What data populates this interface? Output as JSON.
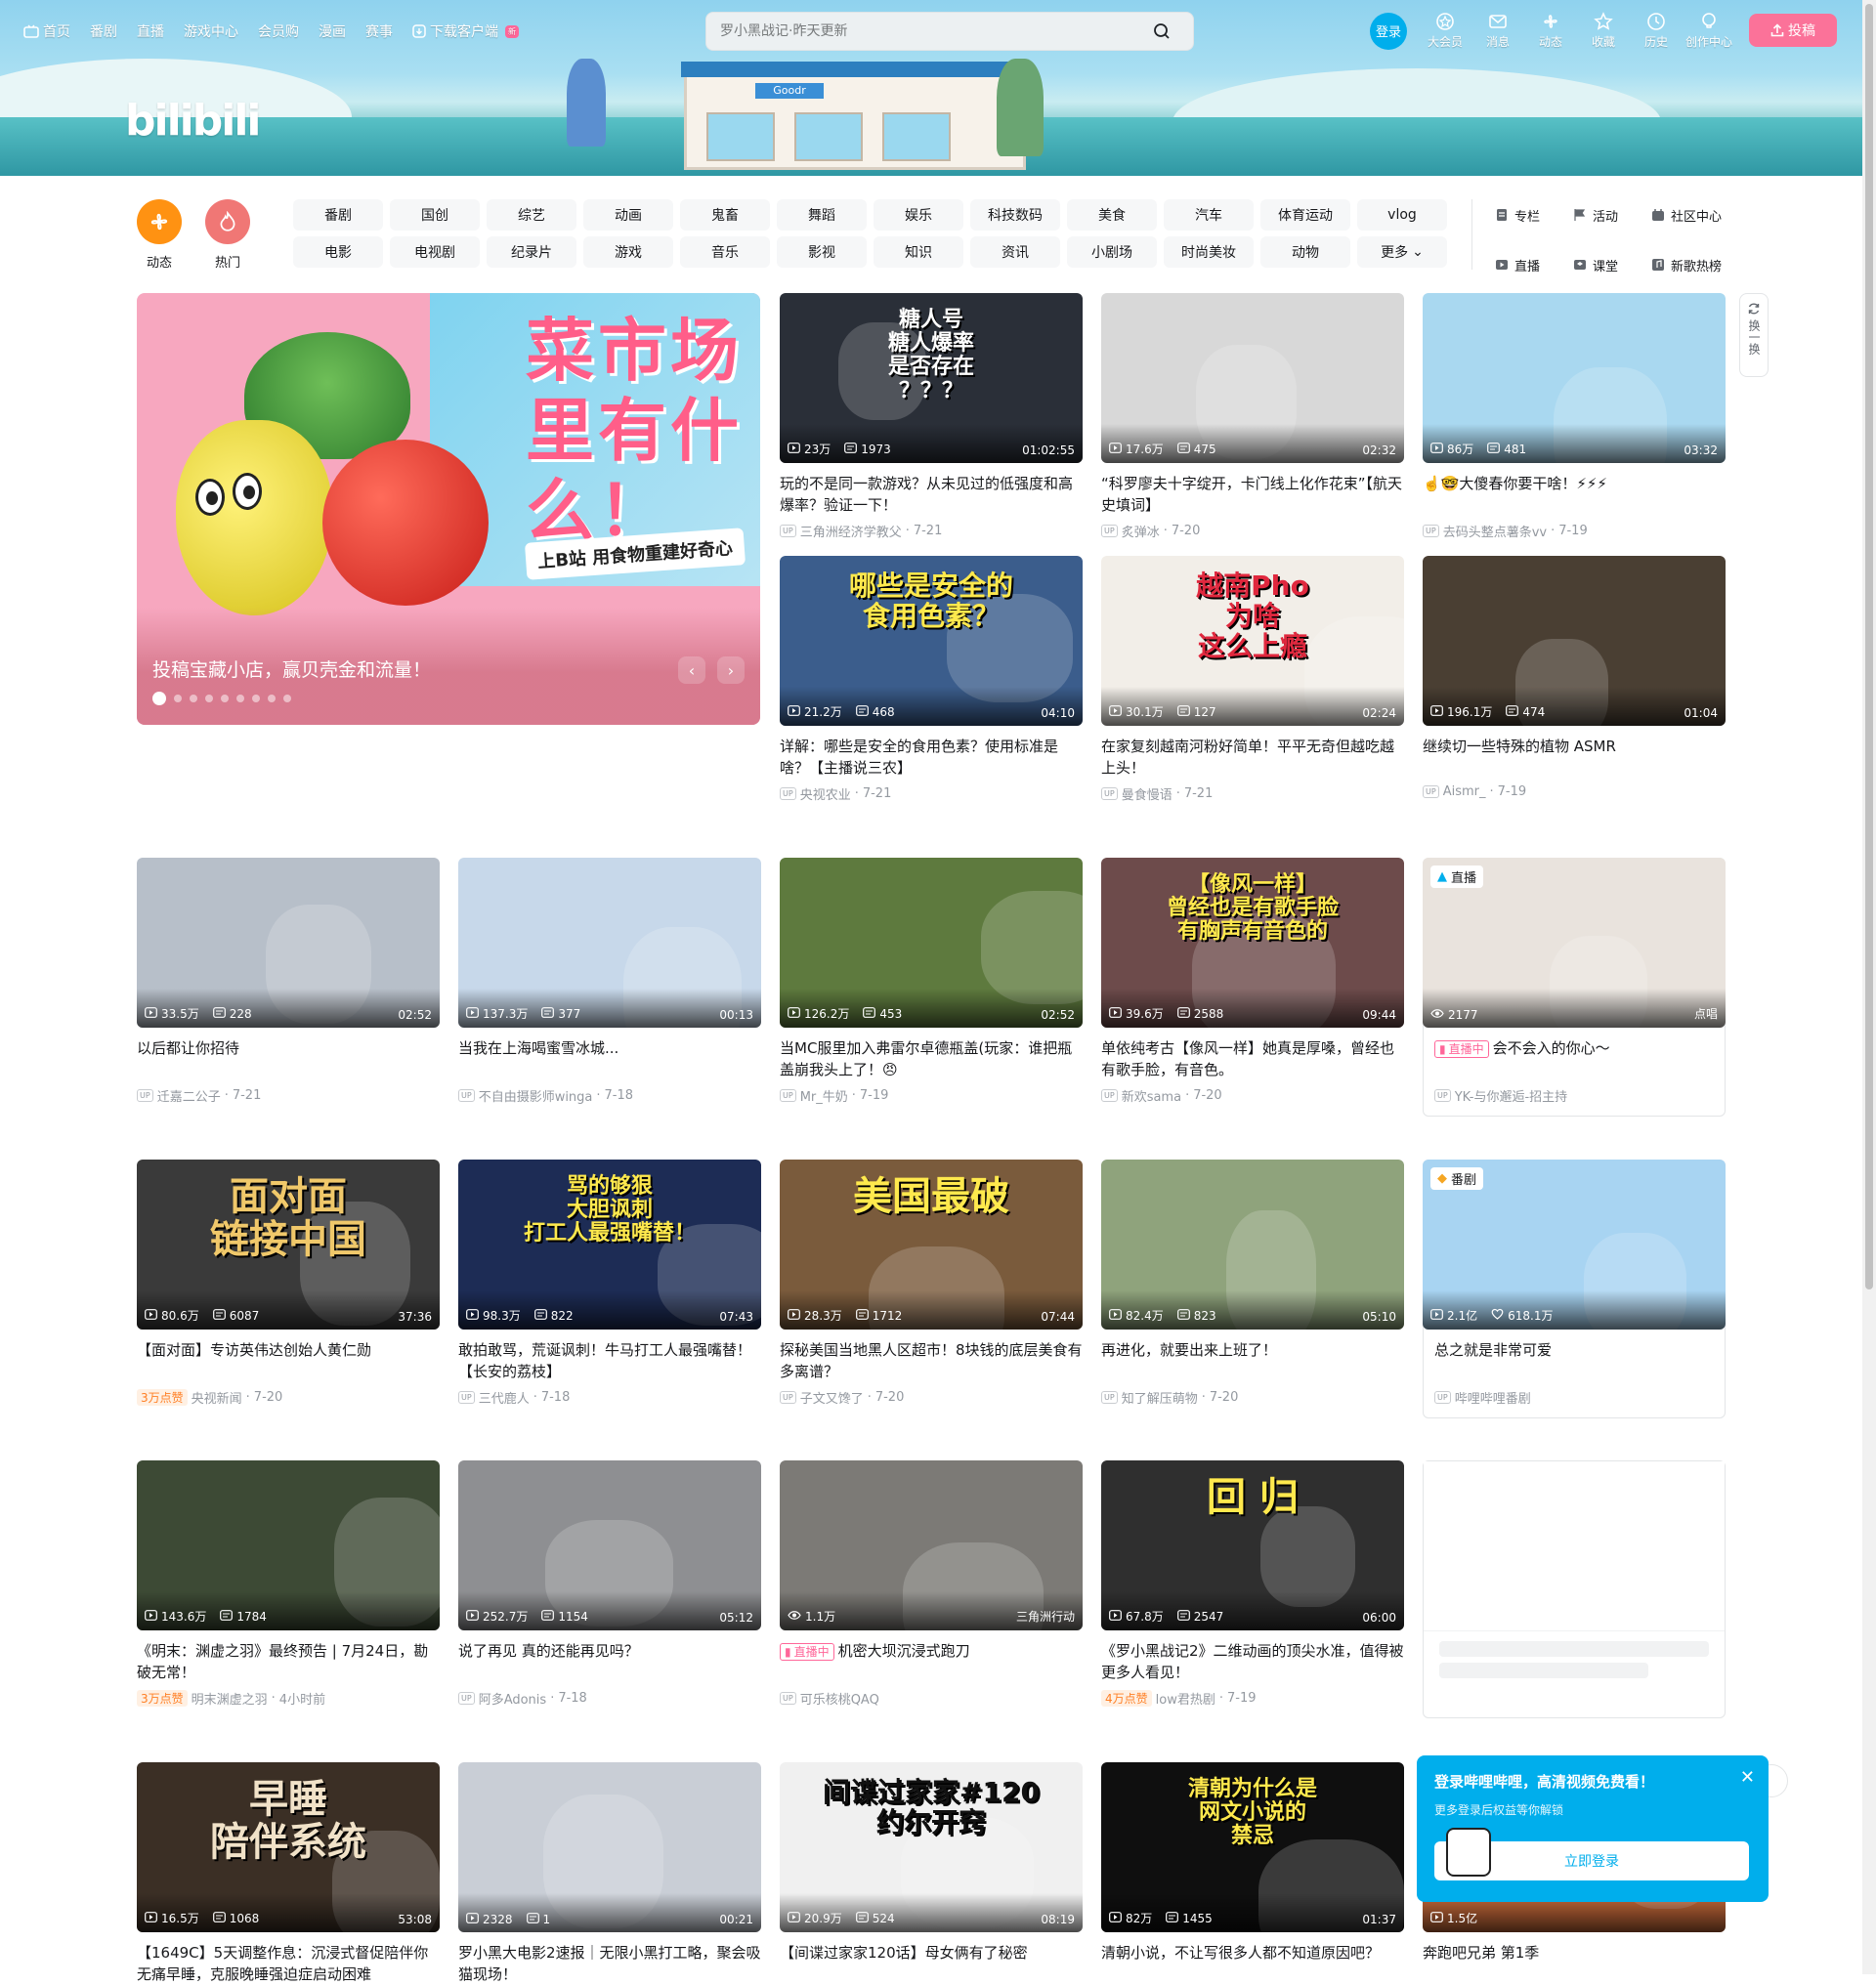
{
  "nav": {
    "left": [
      {
        "label": "首页",
        "icon": "tv-icon"
      },
      {
        "label": "番剧"
      },
      {
        "label": "直播"
      },
      {
        "label": "游戏中心"
      },
      {
        "label": "会员购"
      },
      {
        "label": "漫画"
      },
      {
        "label": "赛事"
      },
      {
        "label": "下载客户端",
        "icon": "download-icon",
        "badge": "新"
      }
    ],
    "search_placeholder": "罗小黑战记·昨天更新",
    "login": "登录",
    "right": [
      {
        "label": "大会员",
        "icon": "vip-icon"
      },
      {
        "label": "消息",
        "icon": "message-icon"
      },
      {
        "label": "动态",
        "icon": "dynamic-icon"
      },
      {
        "label": "收藏",
        "icon": "star-icon"
      },
      {
        "label": "历史",
        "icon": "clock-icon"
      },
      {
        "label": "创作中心",
        "icon": "bulb-icon"
      }
    ],
    "upload": "投稿"
  },
  "banner": {
    "logo": "bilibili",
    "store_sign": "Goodr"
  },
  "channels": {
    "big": [
      {
        "label": "动态",
        "color": "#ff9212"
      },
      {
        "label": "热门",
        "color": "#f07775"
      }
    ],
    "grid": [
      "番剧",
      "国创",
      "综艺",
      "动画",
      "鬼畜",
      "舞蹈",
      "娱乐",
      "科技数码",
      "美食",
      "汽车",
      "体育运动",
      "vlog",
      "电影",
      "电视剧",
      "纪录片",
      "游戏",
      "音乐",
      "影视",
      "知识",
      "资讯",
      "小剧场",
      "时尚美妆",
      "动物",
      "更多"
    ],
    "right": [
      {
        "label": "专栏",
        "icon": "column-icon"
      },
      {
        "label": "活动",
        "icon": "flag-icon"
      },
      {
        "label": "社区中心",
        "icon": "community-icon"
      },
      {
        "label": "直播",
        "icon": "live-icon"
      },
      {
        "label": "课堂",
        "icon": "class-icon"
      },
      {
        "label": "新歌热榜",
        "icon": "music-icon"
      }
    ]
  },
  "carousel": {
    "caption": "投稿宝藏小店，赢贝壳金和流量！",
    "headline": "菜市场里有什么！",
    "subline": "上B站 用食物重建好奇心",
    "dots": 9,
    "active_dot": 0
  },
  "refresh": {
    "label": "换一换"
  },
  "videos": [
    {
      "views": "23万",
      "danmaku": "1973",
      "dur": "01:02:55",
      "title": "玩的不是同一款游戏？从未见过的低强度和高爆率？验证一下！",
      "up": "三角洲经济学教父",
      "date": "7-21",
      "big": "糖人号\n糖人爆率\n是否存在\n？？？",
      "bg": "#2a2f38",
      "big_color": "#ffffff"
    },
    {
      "views": "17.6万",
      "danmaku": "475",
      "dur": "02:32",
      "title": "“科罗廖夫十字绽开，卡门线上化作花束”【航天史填词】",
      "up": "炙弹冰",
      "date": "7-20",
      "big": "",
      "bg": "#d8d8d8",
      "big_color": "#333333"
    },
    {
      "views": "86万",
      "danmaku": "481",
      "dur": "03:32",
      "title": "☝️🤓大傻春你要干啥！⚡⚡⚡",
      "up": "去码头整点薯条vv",
      "date": "7-19",
      "big": "",
      "bg": "#a9d8f0",
      "big_color": "#333333"
    },
    {
      "views": "21.2万",
      "danmaku": "468",
      "dur": "04:10",
      "title": "详解：哪些是安全的食用色素？使用标准是啥？【主播说三农】",
      "up": "央视农业",
      "date": "7-21",
      "big": "哪些是安全的\n食用色素？",
      "bg": "#3b5d8c",
      "big_color": "#ffe94d"
    },
    {
      "views": "30.1万",
      "danmaku": "127",
      "dur": "02:24",
      "title": "在家复刻越南河粉好简单！平平无奇但越吃越上头！",
      "up": "曼食慢语",
      "date": "7-21",
      "big": "越南Pho\n为啥\n这么上瘾",
      "bg": "#f2eee8",
      "big_color": "#e0283e"
    },
    {
      "views": "196.1万",
      "danmaku": "474",
      "dur": "01:04",
      "title": "继续切一些特殊的植物 ASMR",
      "up": "Aismr_",
      "date": "7-19",
      "big": "",
      "bg": "#4a3f33",
      "big_color": "#ffffff"
    },
    {
      "views": "33.5万",
      "danmaku": "228",
      "dur": "02:52",
      "title": "以后都让你招待",
      "up": "迁嘉二公子",
      "date": "7-21",
      "big": "",
      "bg": "#b7bfc9",
      "big_color": "#ffffff"
    },
    {
      "views": "137.3万",
      "danmaku": "377",
      "dur": "00:13",
      "title": "当我在上海喝蜜雪冰城...",
      "up": "不自由摄影师winga",
      "date": "7-18",
      "big": "",
      "bg": "#c7d8ea",
      "big_color": "#ffffff"
    },
    {
      "views": "126.2万",
      "danmaku": "453",
      "dur": "02:52",
      "title": "当MC服里加入弗雷尔卓德瓶盖(玩家：谁把瓶盖崩我头上了！😠",
      "up": "Mr_牛奶",
      "date": "7-19",
      "big": "",
      "bg": "#5e7a3e",
      "big_color": "#ffffff"
    },
    {
      "views": "39.6万",
      "danmaku": "2588",
      "dur": "09:44",
      "title": "单依纯考古【像风一样】她真是厚嗓，曾经也有歌手脸，有音色。",
      "up": "新欢sama",
      "date": "7-20",
      "big": "【像风一样】\n曾经也是有歌手脸\n有胸声有音色的",
      "bg": "#6d4b4b",
      "big_color": "#ffe94d"
    },
    {
      "live": true,
      "views": "2177",
      "tag": "直播",
      "corner": "点唱",
      "title": "会不会入的你心～",
      "up": "YK-与你邂逅-招主持",
      "date": "",
      "big": "",
      "bg": "#e9e3dd",
      "big_color": "#ffffff",
      "live_label": "直播中"
    },
    {
      "views": "80.6万",
      "danmaku": "6087",
      "dur": "37:36",
      "title": "【面对面】专访英伟达创始人黄仁勋",
      "up": "央视新闻",
      "date": "7-20",
      "hot": "3万点赞",
      "big": "面对面\n链接中国",
      "bg": "#3a3a3a",
      "big_color": "#f0c86a"
    },
    {
      "views": "98.3万",
      "danmaku": "822",
      "dur": "07:43",
      "title": "敢拍敢骂，荒诞讽刺！牛马打工人最强嘴替！【长安的荔枝】",
      "up": "三代鹿人",
      "date": "7-18",
      "big": "骂的够狠\n大胆讽刺\n打工人最强嘴替！",
      "bg": "#1d2c55",
      "big_color": "#ffe94d"
    },
    {
      "views": "28.3万",
      "danmaku": "1712",
      "dur": "07:44",
      "title": "探秘美国当地黑人区超市！8块钱的底层美食有多离谱？",
      "up": "子文又馋了",
      "date": "7-20",
      "big": "美国最破",
      "bg": "#7a5b3c",
      "big_color": "#ffe94d"
    },
    {
      "views": "82.4万",
      "danmaku": "823",
      "dur": "05:10",
      "title": "再进化，就要出来上班了！",
      "up": "知了解压萌物",
      "date": "7-20",
      "big": "",
      "bg": "#8fa37c",
      "big_color": "#ffffff"
    },
    {
      "bangumi": true,
      "views": "2.1亿",
      "likes": "618.1万",
      "tag": "番剧",
      "title": "总之就是非常可爱",
      "up": "哔哩哔哩番剧",
      "date": "",
      "big": "",
      "bg": "#a8d4f2",
      "big_color": "#ffffff"
    },
    {
      "views": "143.6万",
      "danmaku": "1784",
      "dur": "",
      "title": "《明末：渊虚之羽》最终预告 | 7月24日，勘破无常！",
      "up": "明末渊虚之羽",
      "date": "4小时前",
      "hot": "3万点赞",
      "big": "",
      "bg": "#3d4a35",
      "big_color": "#ffffff"
    },
    {
      "views": "252.7万",
      "danmaku": "1154",
      "dur": "05:12",
      "title": "说了再见 真的还能再见吗？",
      "up": "阿多Adonis",
      "date": "7-18",
      "big": "",
      "bg": "#8e8f92",
      "big_color": "#ffffff"
    },
    {
      "live": true,
      "views": "1.1万",
      "corner": "三角洲行动",
      "title": "机密大坝沉浸式跑刀",
      "up": "可乐核桃QAQ",
      "date": "",
      "big": "",
      "bg": "#7c7a76",
      "big_color": "#ffffff",
      "live_label": "直播中"
    },
    {
      "views": "67.8万",
      "danmaku": "2547",
      "dur": "06:00",
      "title": "《罗小黑战记2》二维动画的顶尖水准，值得被更多人看见！",
      "up": "low君热剧",
      "date": "7-19",
      "hot": "4万点赞",
      "big": "回  归",
      "bg": "#2f2f2f",
      "big_color": "#ffe94d"
    },
    {
      "views": "16.5万",
      "danmaku": "1068",
      "dur": "53:08",
      "title": "【1649C】5天调整作息：沉浸式督促陪伴你无痛早睡，克服晚睡强迫症启动困难",
      "up": "",
      "date": "",
      "big": "早睡\n陪伴系统",
      "bg": "#3b2f25",
      "big_color": "#f1e2c8"
    },
    {
      "views": "2328",
      "danmaku": "1",
      "dur": "00:21",
      "title": "罗小黑大电影2速报｜无限小黑打工略，聚会吸猫现场！",
      "up": "",
      "date": "",
      "big": "",
      "bg": "#c9ced6",
      "big_color": "#ffffff"
    },
    {
      "views": "20.9万",
      "danmaku": "524",
      "dur": "08:19",
      "title": "【间谍过家家120话】母女俩有了秘密",
      "up": "",
      "date": "",
      "big": "间谍过家家#120\n约尔开窍",
      "bg": "#f0f0f0",
      "big_color": "#111111"
    },
    {
      "views": "82万",
      "danmaku": "1455",
      "dur": "01:37",
      "title": "清朝小说，不让写很多人都不知道原因吧？",
      "up": "",
      "date": "",
      "big": "清朝为什么是\n网文小说的\n禁忌",
      "bg": "#0f0f0f",
      "big_color": "#ffe94d"
    },
    {
      "views": "1.5亿",
      "danmaku": "",
      "dur": "",
      "title": "奔跑吧兄弟 第1季",
      "up": "",
      "date": "",
      "big": "",
      "bg": "#c86a3a",
      "big_color": "#ffffff"
    }
  ],
  "login_popup": {
    "title": "登录哔哩哔哩，高清视频免费看！",
    "subtitle": "更多登录后权益等你解锁",
    "button": "立即登录"
  }
}
